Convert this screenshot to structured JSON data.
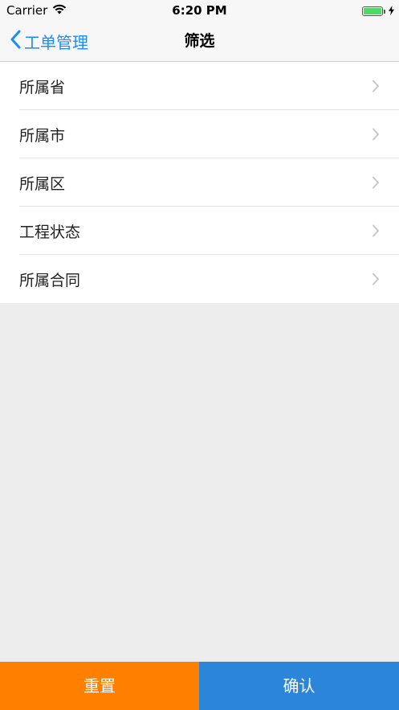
{
  "status_bar": {
    "carrier": "Carrier",
    "time": "6:20 PM"
  },
  "nav": {
    "back_label": "工单管理",
    "title": "筛选"
  },
  "filters": [
    {
      "label": "所属省"
    },
    {
      "label": "所属市"
    },
    {
      "label": "所属区"
    },
    {
      "label": "工程状态"
    },
    {
      "label": "所属合同"
    }
  ],
  "actions": {
    "reset_label": "重置",
    "confirm_label": "确认"
  },
  "colors": {
    "accent": "#1a8cff",
    "reset": "#ff7f00",
    "confirm": "#2b86d9",
    "battery": "#4cd964"
  },
  "icons": {
    "wifi": "wifi-icon",
    "battery": "battery-icon",
    "charging": "charging-bolt-icon",
    "back": "chevron-left-icon",
    "disclosure": "chevron-right-icon"
  }
}
